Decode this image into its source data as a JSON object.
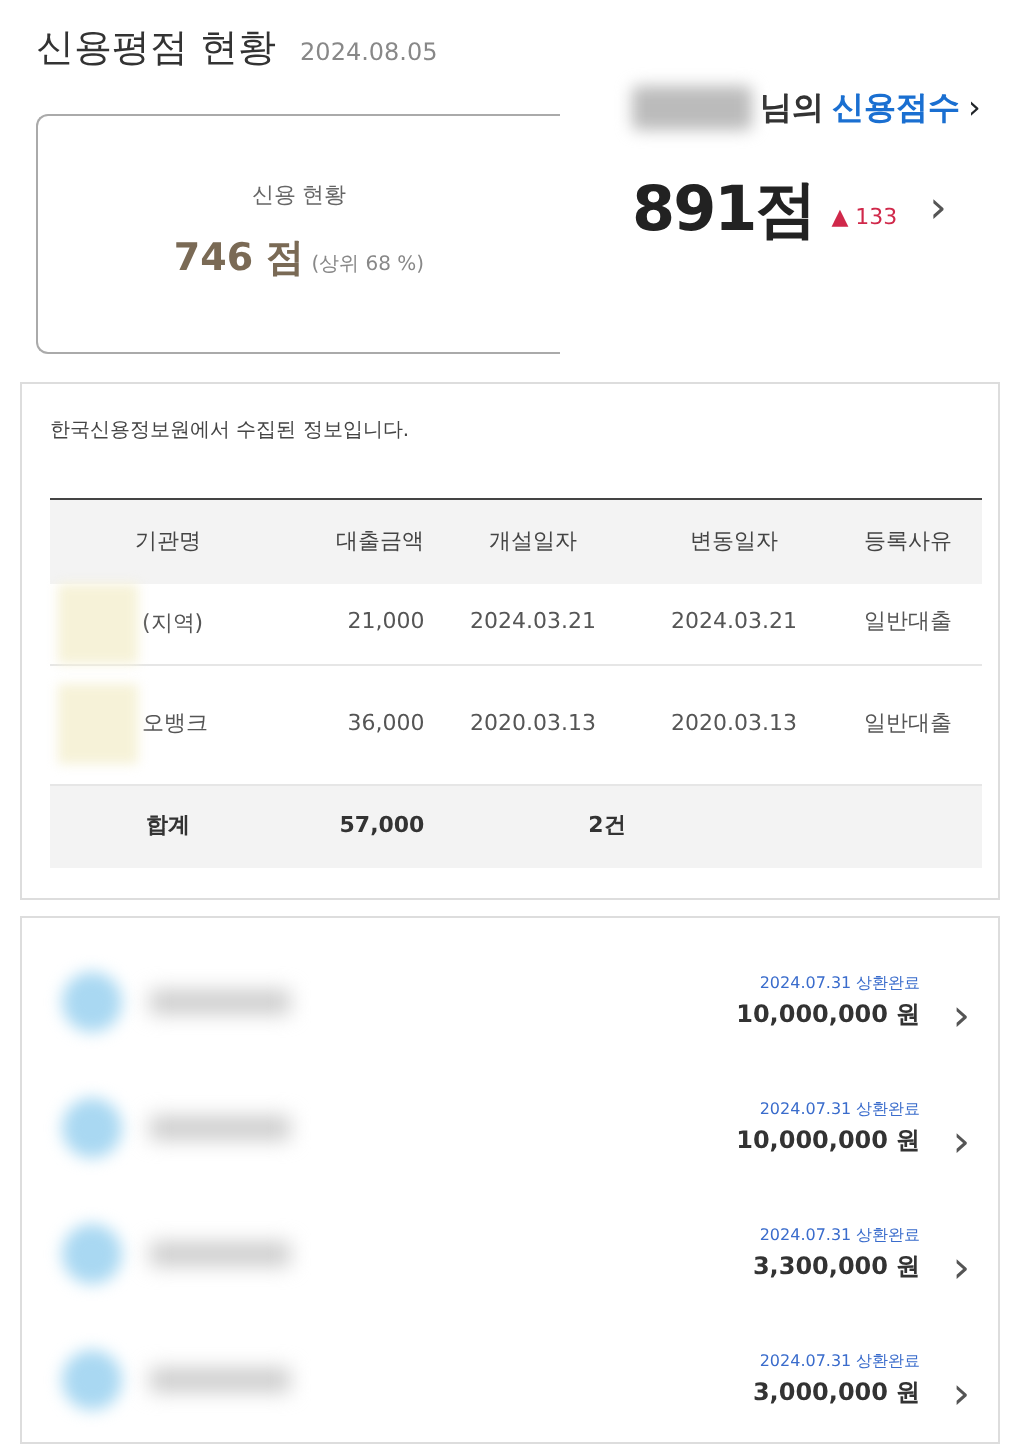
{
  "score_panel": {
    "title": "신용평점 현황",
    "date": "2024.08.05",
    "status_box": {
      "label": "신용 현황",
      "score": "746 점",
      "percentile": "(상위 68 %)"
    },
    "score_card": {
      "suffix": "님의",
      "link": "신용점수",
      "arrow": "›",
      "score": "891점",
      "change_mark": "▲",
      "change": "133",
      "chevron": "›"
    }
  },
  "loan_panel": {
    "note": "한국신용정보원에서 수집된 정보입니다.",
    "table": {
      "columns": [
        "기관명",
        "대출금액",
        "개설일자",
        "변동일자",
        "등록사유"
      ],
      "rows": [
        {
          "cells": [
            "(지역)",
            "21,000",
            "2024.03.21",
            "2024.03.21",
            "일반대출"
          ]
        },
        {
          "cells": [
            "오뱅크",
            "36,000",
            "2020.03.13",
            "2020.03.13",
            "일반대출"
          ]
        }
      ],
      "total": [
        "합계",
        "57,000",
        "2건"
      ]
    }
  },
  "history_panel": {
    "items": [
      {
        "status": "2024.07.31 상환완료",
        "amount": "10,000,000 원",
        "chevron": "›"
      },
      {
        "status": "2024.07.31 상환완료",
        "amount": "10,000,000 원",
        "chevron": "›"
      },
      {
        "status": "2024.07.31 상환완료",
        "amount": "3,300,000 원",
        "chevron": "›"
      },
      {
        "status": "2024.07.31 상환완료",
        "amount": "3,000,000 원",
        "chevron": "›"
      }
    ]
  }
}
